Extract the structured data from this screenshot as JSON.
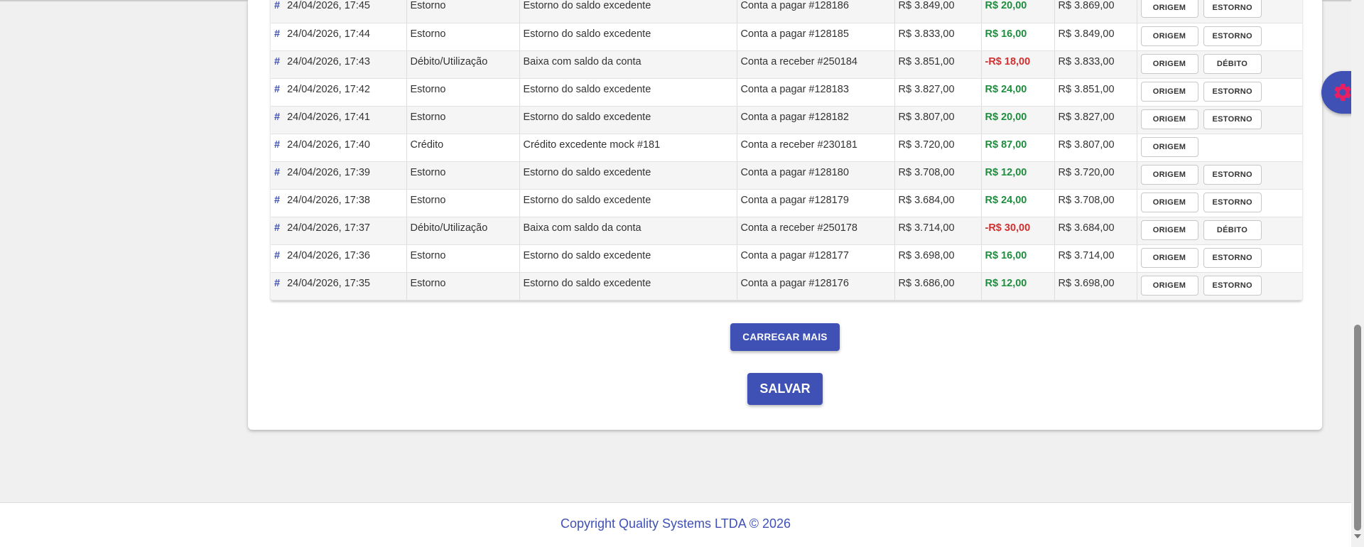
{
  "transactions": [
    {
      "hash": "#",
      "datetime": "24/04/2026, 17:45",
      "type": "Estorno",
      "description": "Estorno do saldo excedente",
      "reference": "Conta a pagar #128186",
      "balance_before": "R$ 3.849,00",
      "value": "R$ 20,00",
      "value_sign": "positive",
      "balance_after": "R$ 3.869,00",
      "origin_label": "ORIGEM",
      "action_label": "ESTORNO"
    },
    {
      "hash": "#",
      "datetime": "24/04/2026, 17:44",
      "type": "Estorno",
      "description": "Estorno do saldo excedente",
      "reference": "Conta a pagar #128185",
      "balance_before": "R$ 3.833,00",
      "value": "R$ 16,00",
      "value_sign": "positive",
      "balance_after": "R$ 3.849,00",
      "origin_label": "ORIGEM",
      "action_label": "ESTORNO"
    },
    {
      "hash": "#",
      "datetime": "24/04/2026, 17:43",
      "type": "Débito/Utilização",
      "description": "Baixa com saldo da conta",
      "reference": "Conta a receber #250184",
      "balance_before": "R$ 3.851,00",
      "value": "-R$ 18,00",
      "value_sign": "negative",
      "balance_after": "R$ 3.833,00",
      "origin_label": "ORIGEM",
      "action_label": "DÉBITO"
    },
    {
      "hash": "#",
      "datetime": "24/04/2026, 17:42",
      "type": "Estorno",
      "description": "Estorno do saldo excedente",
      "reference": "Conta a pagar #128183",
      "balance_before": "R$ 3.827,00",
      "value": "R$ 24,00",
      "value_sign": "positive",
      "balance_after": "R$ 3.851,00",
      "origin_label": "ORIGEM",
      "action_label": "ESTORNO"
    },
    {
      "hash": "#",
      "datetime": "24/04/2026, 17:41",
      "type": "Estorno",
      "description": "Estorno do saldo excedente",
      "reference": "Conta a pagar #128182",
      "balance_before": "R$ 3.807,00",
      "value": "R$ 20,00",
      "value_sign": "positive",
      "balance_after": "R$ 3.827,00",
      "origin_label": "ORIGEM",
      "action_label": "ESTORNO"
    },
    {
      "hash": "#",
      "datetime": "24/04/2026, 17:40",
      "type": "Crédito",
      "description": "Crédito excedente mock #181",
      "reference": "Conta a receber #230181",
      "balance_before": "R$ 3.720,00",
      "value": "R$ 87,00",
      "value_sign": "positive",
      "balance_after": "R$ 3.807,00",
      "origin_label": "ORIGEM",
      "action_label": ""
    },
    {
      "hash": "#",
      "datetime": "24/04/2026, 17:39",
      "type": "Estorno",
      "description": "Estorno do saldo excedente",
      "reference": "Conta a pagar #128180",
      "balance_before": "R$ 3.708,00",
      "value": "R$ 12,00",
      "value_sign": "positive",
      "balance_after": "R$ 3.720,00",
      "origin_label": "ORIGEM",
      "action_label": "ESTORNO"
    },
    {
      "hash": "#",
      "datetime": "24/04/2026, 17:38",
      "type": "Estorno",
      "description": "Estorno do saldo excedente",
      "reference": "Conta a pagar #128179",
      "balance_before": "R$ 3.684,00",
      "value": "R$ 24,00",
      "value_sign": "positive",
      "balance_after": "R$ 3.708,00",
      "origin_label": "ORIGEM",
      "action_label": "ESTORNO"
    },
    {
      "hash": "#",
      "datetime": "24/04/2026, 17:37",
      "type": "Débito/Utilização",
      "description": "Baixa com saldo da conta",
      "reference": "Conta a receber #250178",
      "balance_before": "R$ 3.714,00",
      "value": "-R$ 30,00",
      "value_sign": "negative",
      "balance_after": "R$ 3.684,00",
      "origin_label": "ORIGEM",
      "action_label": "DÉBITO"
    },
    {
      "hash": "#",
      "datetime": "24/04/2026, 17:36",
      "type": "Estorno",
      "description": "Estorno do saldo excedente",
      "reference": "Conta a pagar #128177",
      "balance_before": "R$ 3.698,00",
      "value": "R$ 16,00",
      "value_sign": "positive",
      "balance_after": "R$ 3.714,00",
      "origin_label": "ORIGEM",
      "action_label": "ESTORNO"
    },
    {
      "hash": "#",
      "datetime": "24/04/2026, 17:35",
      "type": "Estorno",
      "description": "Estorno do saldo excedente",
      "reference": "Conta a pagar #128176",
      "balance_before": "R$ 3.686,00",
      "value": "R$ 12,00",
      "value_sign": "positive",
      "balance_after": "R$ 3.698,00",
      "origin_label": "ORIGEM",
      "action_label": "ESTORNO"
    }
  ],
  "buttons": {
    "load_more": "CARREGAR MAIS",
    "save": "SALVAR"
  },
  "footer": {
    "copyright": "Copyright Quality Systems LTDA © 2026"
  },
  "icons": {
    "row_link": "hash-icon",
    "settings": "gear-icon"
  },
  "colors": {
    "primary": "#3f51b5",
    "positive": "#1e8e3e",
    "negative": "#d32f2f",
    "settings_gear": "#e91e63"
  }
}
